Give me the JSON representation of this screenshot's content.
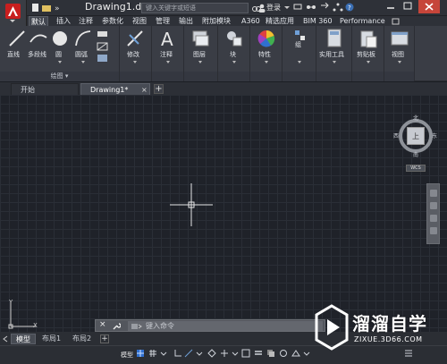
{
  "titlebar": {
    "document_title": "Drawing1.d...",
    "search_placeholder": "键入关键字或短语",
    "login_label": "登录"
  },
  "ribbon_tabs": [
    "默认",
    "插入",
    "注释",
    "参数化",
    "视图",
    "管理",
    "输出",
    "附加模块",
    "A360",
    "精选应用",
    "BIM 360",
    "Performance"
  ],
  "ribbon": {
    "draw": {
      "tools": [
        "直线",
        "多段线",
        "圆",
        "圆弧"
      ],
      "footer": "绘图"
    },
    "modify": {
      "label": "修改"
    },
    "annotate": {
      "label": "注释"
    },
    "layers": {
      "label": "图层"
    },
    "block": {
      "label": "块"
    },
    "properties": {
      "label": "特性"
    },
    "group": {
      "label": "组"
    },
    "utilities": {
      "label": "实用工具"
    },
    "clipboard": {
      "label": "剪贴板"
    },
    "view": {
      "label": "视图"
    }
  },
  "doc_tabs": {
    "start": "开始",
    "drawing": "Drawing1*"
  },
  "viewcube": {
    "north": "北",
    "south": "南",
    "west": "西",
    "east": "东",
    "top": "上",
    "wcs": "WCS"
  },
  "ucs": {
    "x": "X",
    "y": "Y"
  },
  "command_line": {
    "placeholder": "键入命令"
  },
  "layout_tabs": [
    "模型",
    "布局1",
    "布局2"
  ],
  "status_bar": {
    "model_label": "模型"
  },
  "watermark": {
    "brand": "溜溜自学",
    "url": "ZIXUE.3D66.COM"
  },
  "colors": {
    "accent_red": "#c81f1f",
    "canvas_bg": "#1f2229",
    "ribbon_bg": "#3a3d45",
    "close_button": "#c6453a"
  }
}
